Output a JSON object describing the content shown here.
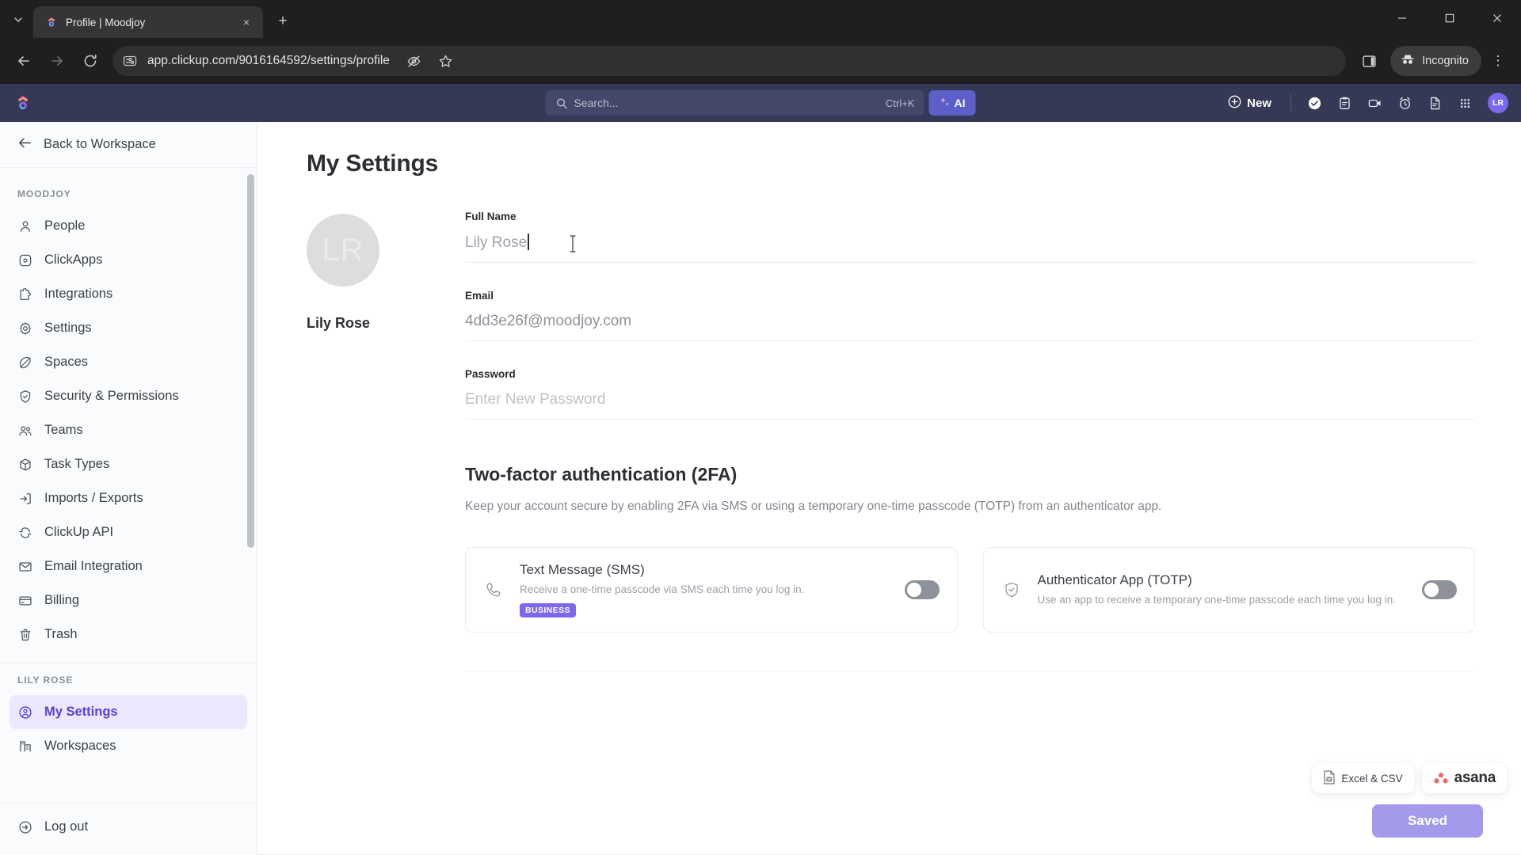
{
  "browser": {
    "tab": {
      "title": "Profile | Moodjoy",
      "favicon": "clickup-favicon",
      "close_label": "×"
    },
    "new_tab_label": "+",
    "tab_list_label": "∨",
    "window": {
      "minimize": "–",
      "maximize": "□",
      "close": "✕"
    },
    "nav": {
      "back": "←",
      "forward": "→",
      "reload": "⟳"
    },
    "url": "app.clickup.com/9016164592/settings/profile",
    "profile_pill": "Incognito",
    "menu_label": "⋮"
  },
  "app_header": {
    "search_placeholder": "Search...",
    "search_shortcut": "Ctrl+K",
    "ai_label": "AI",
    "new_label": "New",
    "avatar_initials": "LR",
    "icons": [
      "check-circle-icon",
      "clipboard-icon",
      "video-camera-icon",
      "alarm-clock-icon",
      "document-icon",
      "apps-grid-icon"
    ]
  },
  "sidebar": {
    "back_label": "Back to Workspace",
    "workspace_group": "MOODJOY",
    "workspace_items": [
      {
        "label": "People",
        "icon": "person-icon"
      },
      {
        "label": "ClickApps",
        "icon": "clickapps-icon"
      },
      {
        "label": "Integrations",
        "icon": "puzzle-icon"
      },
      {
        "label": "Settings",
        "icon": "gear-icon"
      },
      {
        "label": "Spaces",
        "icon": "spaces-icon"
      },
      {
        "label": "Security & Permissions",
        "icon": "shield-icon"
      },
      {
        "label": "Teams",
        "icon": "teams-icon"
      },
      {
        "label": "Task Types",
        "icon": "cube-icon"
      },
      {
        "label": "Imports / Exports",
        "icon": "import-export-icon"
      },
      {
        "label": "ClickUp API",
        "icon": "api-icon"
      },
      {
        "label": "Email Integration",
        "icon": "envelope-icon"
      },
      {
        "label": "Billing",
        "icon": "credit-card-icon"
      },
      {
        "label": "Trash",
        "icon": "trash-icon"
      }
    ],
    "user_group": "LILY ROSE",
    "user_items": [
      {
        "label": "My Settings",
        "icon": "user-circle-icon",
        "active": true
      },
      {
        "label": "Workspaces",
        "icon": "workspaces-icon",
        "active": false
      }
    ],
    "logout": {
      "label": "Log out",
      "icon": "logout-icon"
    }
  },
  "main": {
    "page_title": "My Settings",
    "avatar_initials": "LR",
    "avatar_name": "Lily Rose",
    "fields": [
      {
        "label": "Full Name",
        "value": "Lily Rose",
        "placeholder": "Full Name",
        "focused": true
      },
      {
        "label": "Email",
        "value": "4dd3e26f@moodjoy.com",
        "placeholder": "Email",
        "focused": false
      },
      {
        "label": "Password",
        "value": "",
        "placeholder": "Enter New Password",
        "focused": false
      }
    ],
    "twofa": {
      "title": "Two-factor authentication (2FA)",
      "subtitle": "Keep your account secure by enabling 2FA via SMS or using a temporary one-time passcode (TOTP) from an authenticator app.",
      "cards": [
        {
          "icon": "phone-icon",
          "title": "Text Message (SMS)",
          "desc": "Receive a one-time passcode via SMS each time you log in.",
          "badge": "BUSINESS",
          "toggle_on": false
        },
        {
          "icon": "shield-check-icon",
          "title": "Authenticator App (TOTP)",
          "desc": "Use an app to receive a temporary one-time passcode each time you log in.",
          "badge": "",
          "toggle_on": false
        }
      ]
    },
    "saved_button": "Saved",
    "chips": [
      {
        "icon": "excel-file-icon",
        "label": "Excel & CSV"
      },
      {
        "icon": "asana-logo-icon",
        "label": "asana"
      }
    ]
  },
  "colors": {
    "header_bg": "#363955",
    "accent": "#7b68ee",
    "active_item_bg": "#ebe8fd",
    "active_item_text": "#5b3fd6",
    "saved_button_bg": "#a39aeb",
    "badge_bg": "#7b68ee",
    "asana_red": "#f06a6a"
  }
}
